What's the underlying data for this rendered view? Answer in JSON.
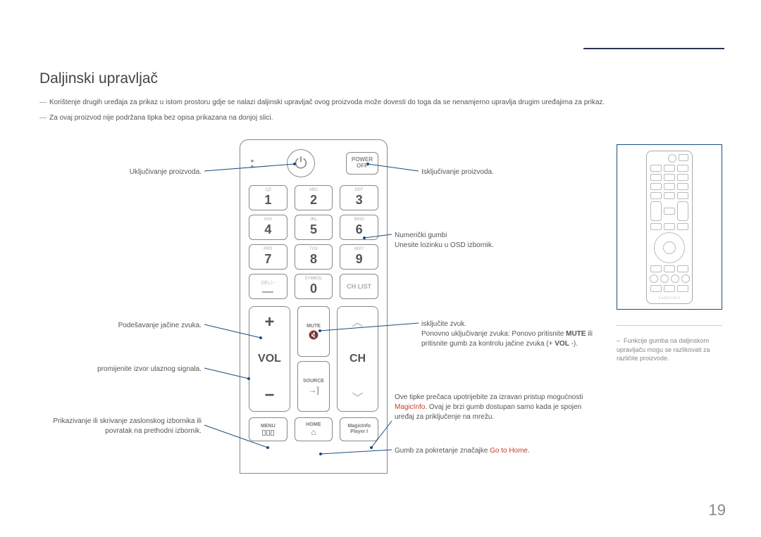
{
  "page": {
    "title": "Daljinski upravljač",
    "number": "19",
    "note1": "Korištenje drugih uređaja za prikaz u istom prostoru gdje se nalazi daljinski upravljač ovog proizvoda može dovesti do toga da se nenamjerno upravlja drugim uređajima za prikaz.",
    "note2": "Za ovaj proizvod nije podržana tipka bez opisa prikazana na donjoj slici."
  },
  "remote": {
    "power_off_top": "POWER",
    "power_off_bottom": "OFF",
    "vol_label": "VOL",
    "ch_label": "CH",
    "mute_label": "MUTE",
    "source_label": "SOURCE",
    "menu_label": "MENU",
    "home_label": "HOME",
    "magic_top": "MagicInfo",
    "magic_bottom": "Player I",
    "chlist_label": "CH LIST",
    "del_label": "DEL/--",
    "symbol_label": "SYMBOL",
    "keys": [
      {
        "n": "1",
        "s": ".QZ"
      },
      {
        "n": "2",
        "s": "ABC"
      },
      {
        "n": "3",
        "s": "DEF"
      },
      {
        "n": "4",
        "s": "GHI"
      },
      {
        "n": "5",
        "s": "JKL"
      },
      {
        "n": "6",
        "s": "MNO"
      },
      {
        "n": "7",
        "s": "PRS"
      },
      {
        "n": "8",
        "s": "TUV"
      },
      {
        "n": "9",
        "s": "WXY"
      }
    ]
  },
  "mini": {
    "brand": "SAMSUNG",
    "note": "Funkcije gumba na daljinskom upravljaču mogu se razlikovati za različite proizvode."
  },
  "callouts": {
    "left1": "Uključivanje proizvoda.",
    "left2": "Podešavanje jačine zvuka.",
    "left3": "promijenite izvor ulaznog signala.",
    "left4": "Prikazivanje ili skrivanje zaslonskog izbornika ili povratak na prethodni izbornik.",
    "right1": "Isključivanje proizvoda.",
    "right2a": "Numerički gumbi",
    "right2b": "Unesite lozinku u OSD izbornik.",
    "right3a": "isključite zvuk.",
    "right3b_pre": "Ponovno uključivanje zvuka: Ponovo pritisnite ",
    "right3b_mute": "MUTE",
    "right3b_mid": " ili pritisnite gumb za kontrolu jačine zvuka (+ ",
    "right3b_vol": "VOL",
    "right3b_post": " -).",
    "right4_pre": "Ove tipke prečaca upotrijebite za izravan pristup mogućnosti ",
    "right4_red": "MagicInfo",
    "right4_post": ". Ovaj je brzi gumb dostupan samo kada je spojen uređaj za priključenje na mrežu.",
    "right5_pre": "Gumb za pokretanje značajke ",
    "right5_red": "Go to Home"
  }
}
